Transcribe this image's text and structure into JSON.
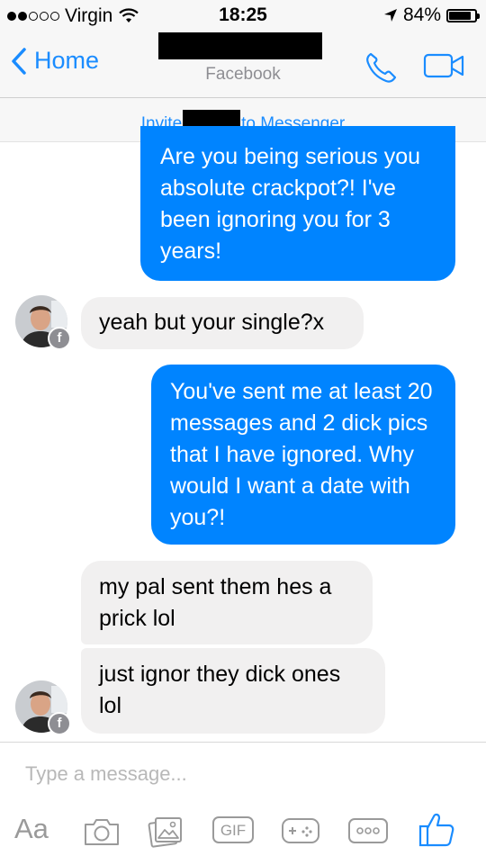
{
  "status_bar": {
    "carrier": "Virgin",
    "time": "18:25",
    "battery": "84%",
    "signal_dots_filled": 2,
    "signal_dots_total": 5
  },
  "nav": {
    "back_label": "Home",
    "subtitle": "Facebook",
    "icons": [
      "chevron-left-icon",
      "phone-icon",
      "video-camera-icon"
    ]
  },
  "invite": {
    "prefix": "Invite",
    "suffix": "to Messenger"
  },
  "messages": [
    {
      "side": "out",
      "text": "Are you being serious you absolute crackpot?! I've been ignoring you for 3 years!"
    },
    {
      "side": "in",
      "text": "yeah but your single?x"
    },
    {
      "side": "out",
      "text": "You've sent me at least 20 messages and 2 dick pics that I have ignored. Why would I want a date with you?!"
    },
    {
      "side": "in",
      "text": "my pal sent them hes a prick lol"
    },
    {
      "side": "in",
      "text": "just ignor they dick ones lol"
    }
  ],
  "composer": {
    "placeholder": "Type a message...",
    "aa_label": "Aa",
    "gif_label": "GIF",
    "tools": [
      "camera-icon",
      "photo-icon",
      "gif-icon",
      "game-controller-icon",
      "more-icon",
      "thumbs-up-icon"
    ]
  },
  "colors": {
    "accent": "#1a8cff",
    "outgoing_bubble": "#0084ff",
    "incoming_bubble": "#f1f0f0"
  }
}
